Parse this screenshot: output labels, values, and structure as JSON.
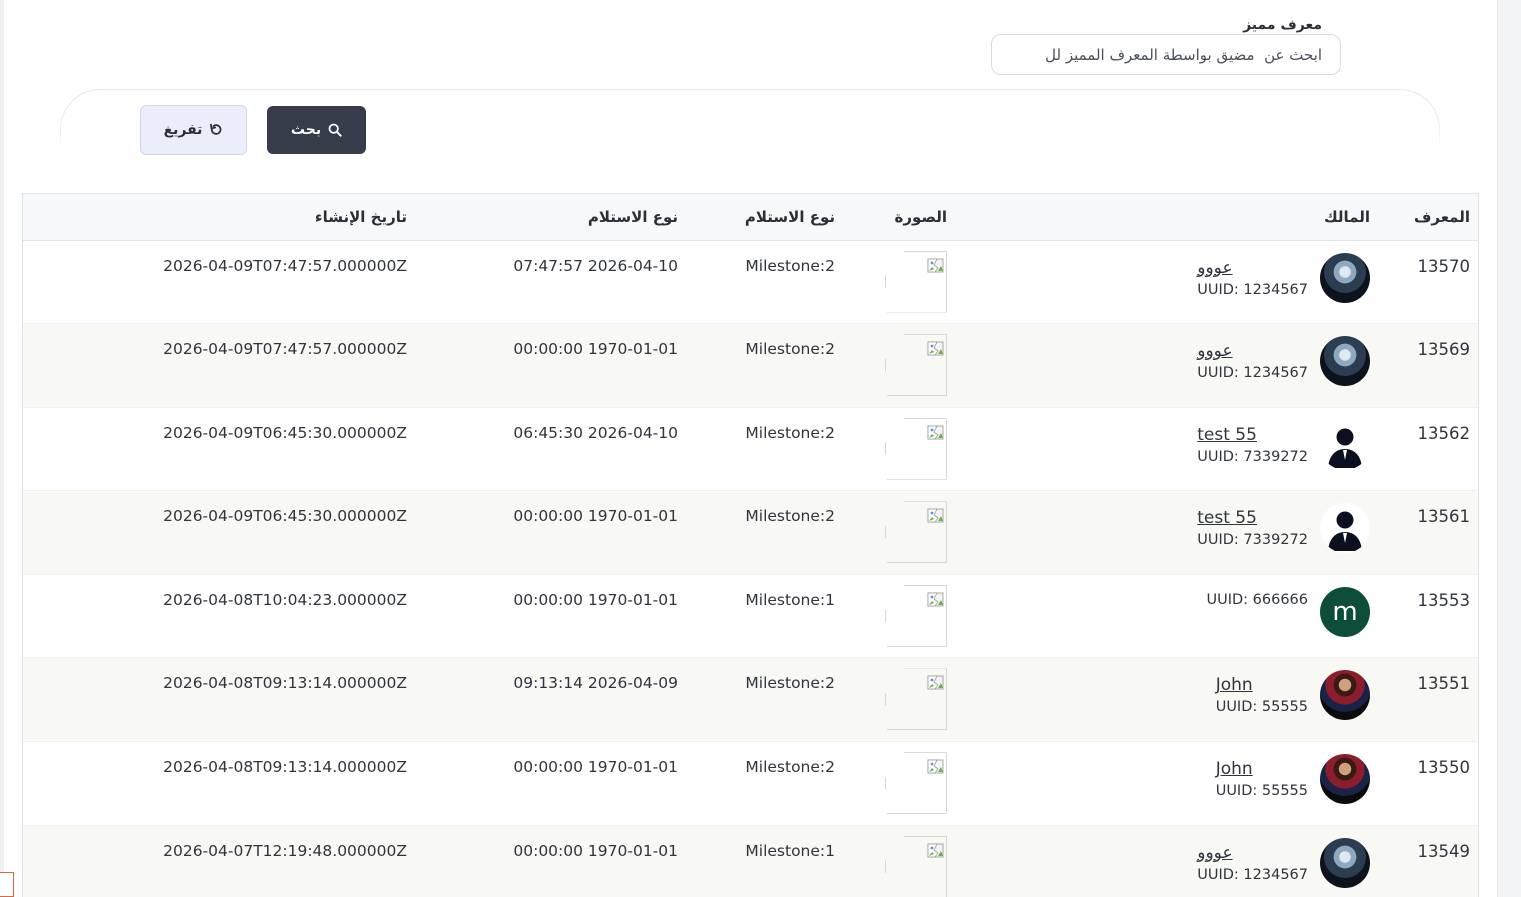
{
  "filter": {
    "label": "معرف مميز",
    "placeholder": "ابحث عن  مضيق بواسطة المعرف المميز لل"
  },
  "actions": {
    "search_label": "بحث",
    "clear_label": "تفريغ"
  },
  "table": {
    "headers": [
      "المعرف",
      "المالك",
      "الصورة",
      "نوع الاستلام",
      "نوع الاستلام",
      "تاريخ الإنشاء"
    ],
    "rows": [
      {
        "id": "13570",
        "owner_name": "عووو",
        "uuid": "UUID: 1234567",
        "avatar": "owl",
        "milestone": "Milestone:2",
        "received_at": "07:47:57 2026-04-10",
        "created_at": "2026-04-09T07:47:57.000000Z"
      },
      {
        "id": "13569",
        "owner_name": "عووو",
        "uuid": "UUID: 1234567",
        "avatar": "owl",
        "milestone": "Milestone:2",
        "received_at": "00:00:00 1970-01-01",
        "created_at": "2026-04-09T07:47:57.000000Z"
      },
      {
        "id": "13562",
        "owner_name": "test 55",
        "uuid": "UUID: 7339272",
        "avatar": "silhouette",
        "milestone": "Milestone:2",
        "received_at": "06:45:30 2026-04-10",
        "created_at": "2026-04-09T06:45:30.000000Z"
      },
      {
        "id": "13561",
        "owner_name": "test 55",
        "uuid": "UUID: 7339272",
        "avatar": "silhouette",
        "milestone": "Milestone:2",
        "received_at": "00:00:00 1970-01-01",
        "created_at": "2026-04-09T06:45:30.000000Z"
      },
      {
        "id": "13553",
        "owner_name": "",
        "uuid": "UUID: 666666",
        "avatar": "letter",
        "avatar_letter": "m",
        "milestone": "Milestone:1",
        "received_at": "00:00:00 1970-01-01",
        "created_at": "2026-04-08T10:04:23.000000Z"
      },
      {
        "id": "13551",
        "owner_name": "John",
        "uuid": "UUID: 55555",
        "avatar": "player",
        "milestone": "Milestone:2",
        "received_at": "09:13:14 2026-04-09",
        "created_at": "2026-04-08T09:13:14.000000Z"
      },
      {
        "id": "13550",
        "owner_name": "John",
        "uuid": "UUID: 55555",
        "avatar": "player",
        "milestone": "Milestone:2",
        "received_at": "00:00:00 1970-01-01",
        "created_at": "2026-04-08T09:13:14.000000Z"
      },
      {
        "id": "13549",
        "owner_name": "عووو",
        "uuid": "UUID: 1234567",
        "avatar": "owl",
        "milestone": "Milestone:1",
        "received_at": "00:00:00 1970-01-01",
        "created_at": "2026-04-07T12:19:48.000000Z"
      }
    ]
  },
  "icons": {
    "search": "search-icon",
    "clear": "refresh-icon",
    "broken_image": "broken-image-icon"
  },
  "colors": {
    "primary_button": "#373c4b",
    "clear_button": "#e9eefa",
    "letter_avatar": "#0e4d3a"
  }
}
